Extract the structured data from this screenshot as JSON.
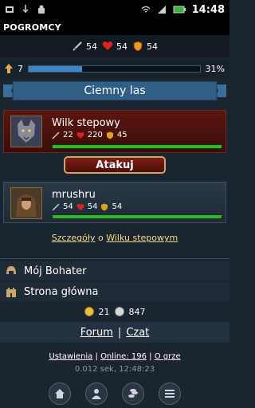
{
  "statusbar": {
    "time": "14:48"
  },
  "app": {
    "title": "POGROMCY"
  },
  "player_stats": {
    "attack": "54",
    "health": "54",
    "defense": "54"
  },
  "level": {
    "value": "7",
    "progress_percent": "31%",
    "progress_fraction": 0.31
  },
  "location": {
    "title": "Ciemny las"
  },
  "enemy": {
    "name": "Wilk stepowy",
    "attack": "22",
    "health": "220",
    "defense": "45",
    "hp_fraction": 1.0
  },
  "attack_button": {
    "label": "Atakuj"
  },
  "player": {
    "name": "mrushru",
    "attack": "54",
    "health": "54",
    "defense": "54",
    "hp_fraction": 1.0
  },
  "details": {
    "prefix": "Szczegóły",
    "mid": "o",
    "suffix": "Wilku stepowym"
  },
  "menu": {
    "hero": "Mój Bohater",
    "home": "Strona główna"
  },
  "currency": {
    "gold": "21",
    "silver": "847"
  },
  "community": {
    "forum": "Forum",
    "sep": "|",
    "chat": "Czat"
  },
  "footer": {
    "settings": "Ustawienia",
    "online": "Online: 196",
    "about": "O grze",
    "sep": "|",
    "timing": "0.012 sek, 12:48:23"
  },
  "colors": {
    "accent_red": "#7e1e14",
    "hp_green": "#2fb62b",
    "xp_blue": "#3c87c7",
    "link_gold": "#f5d98a"
  }
}
